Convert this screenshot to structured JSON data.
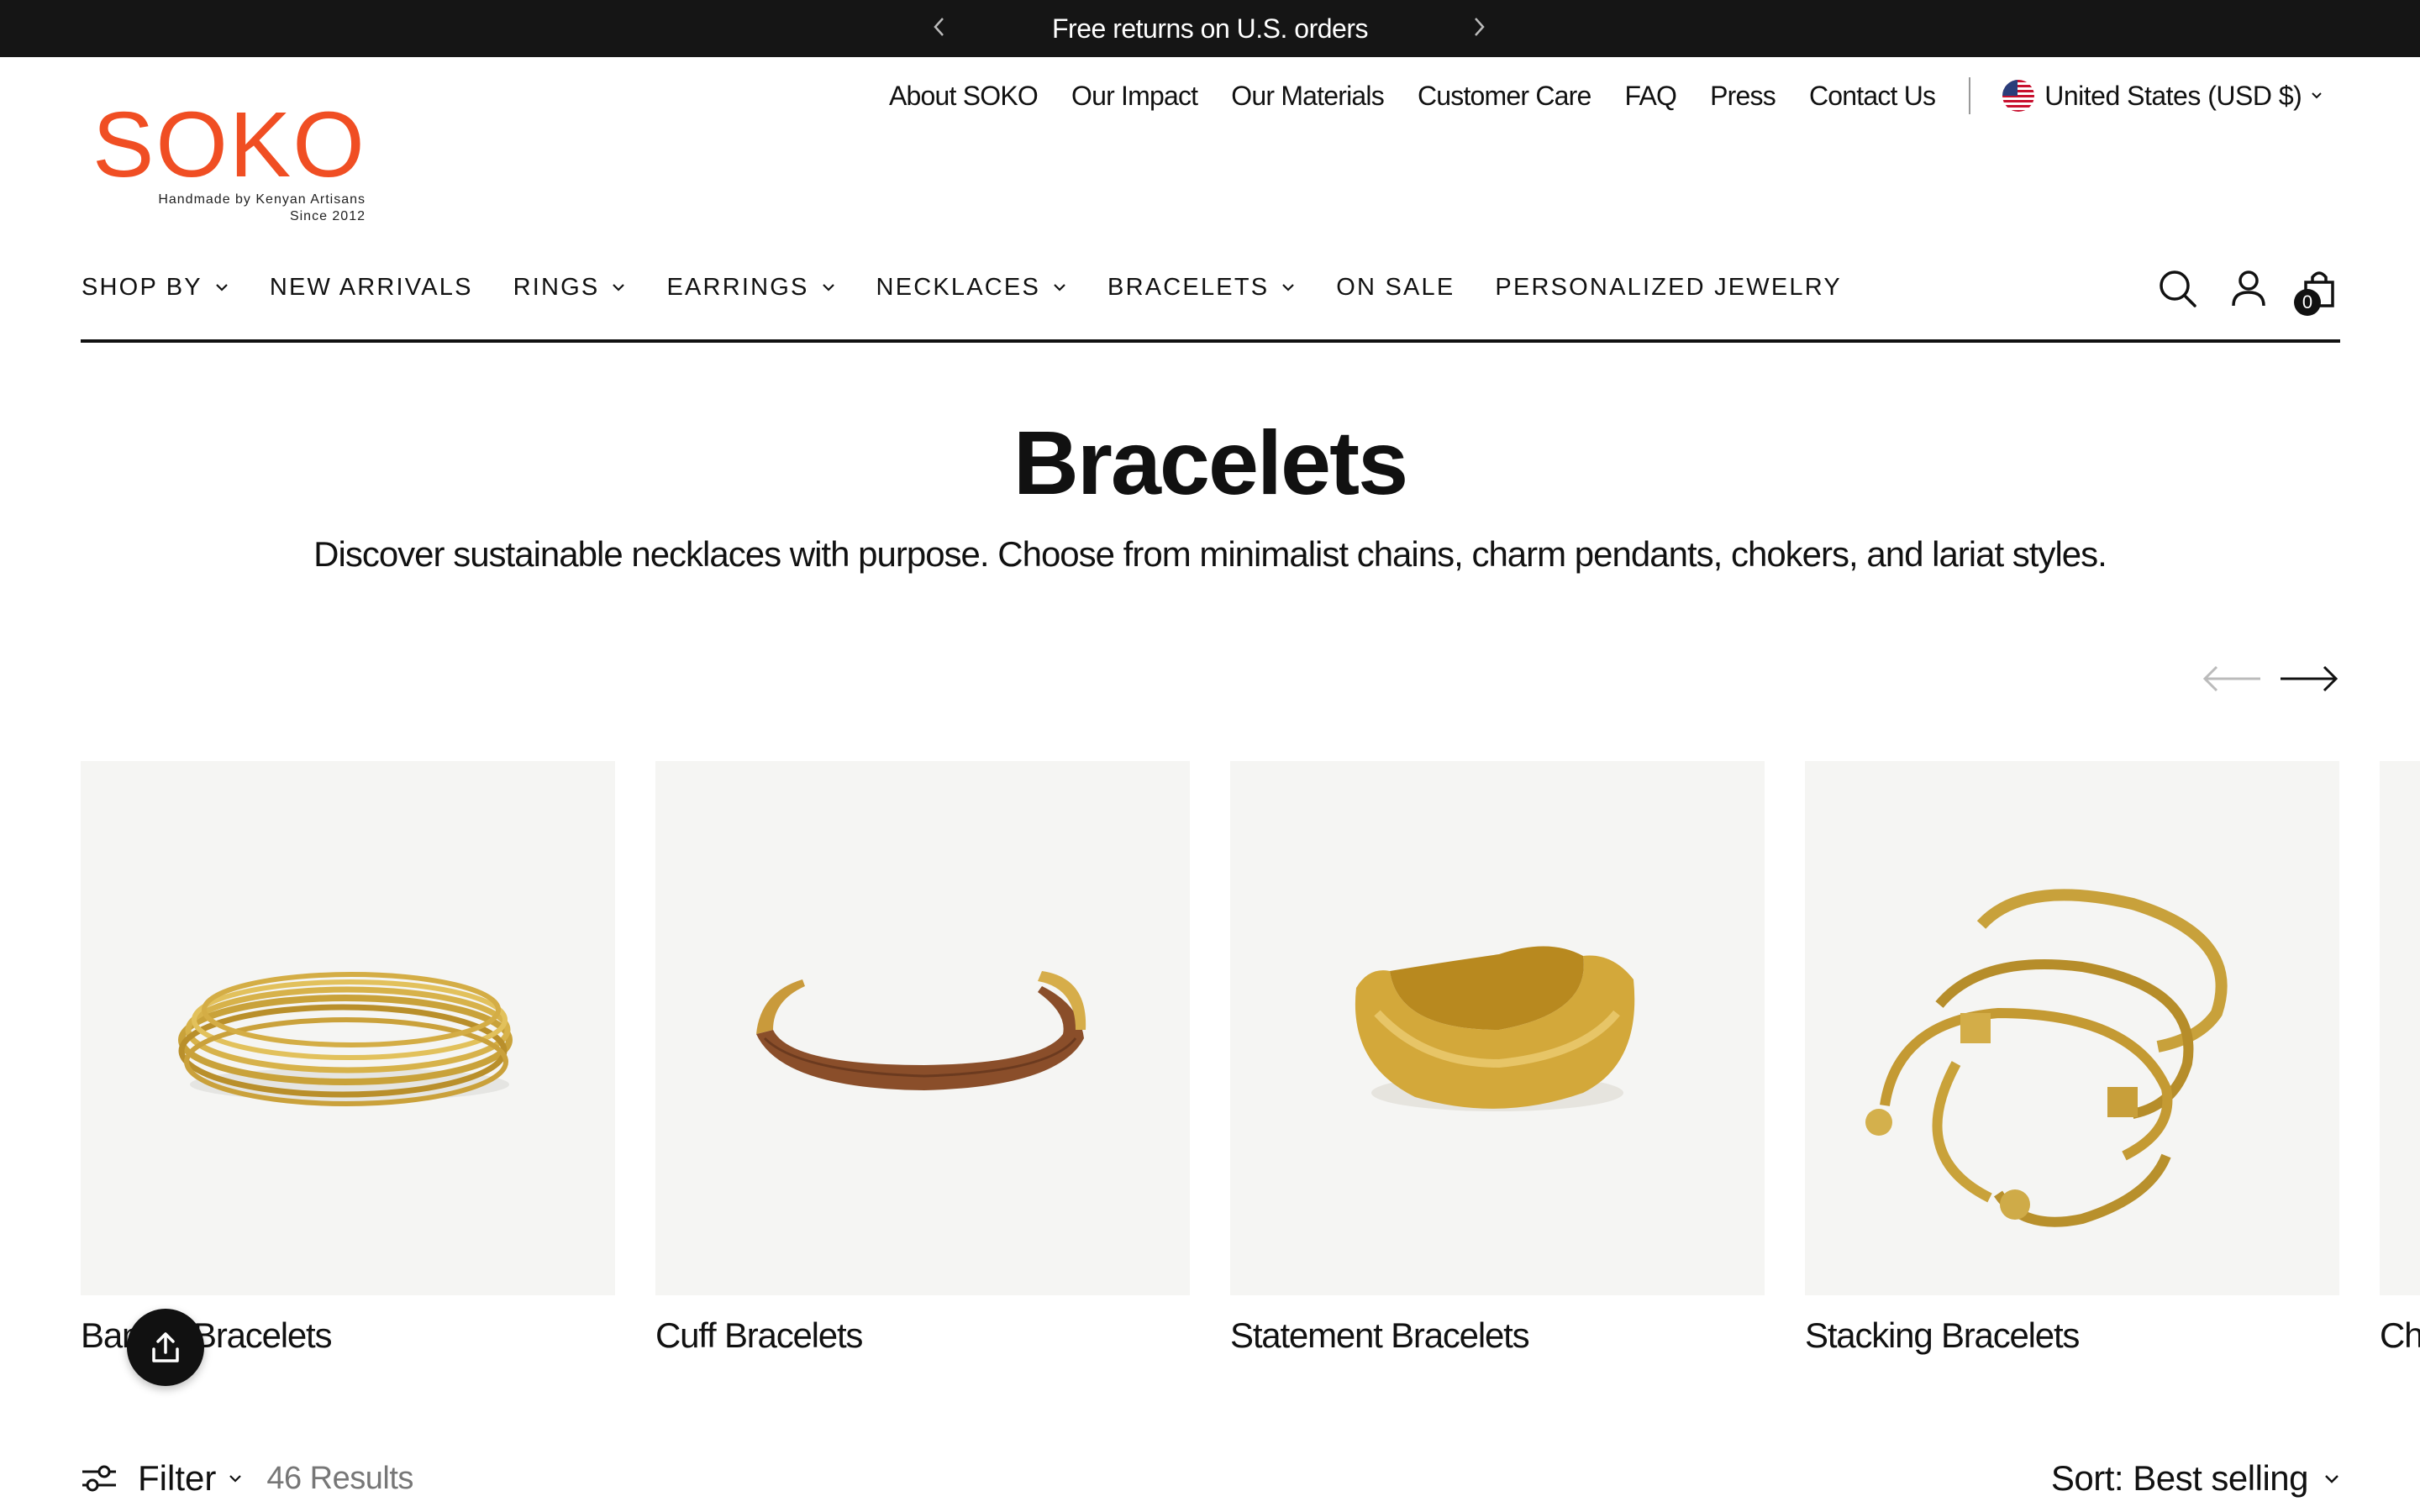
{
  "announcement": {
    "message": "Free returns on U.S. orders",
    "prev_icon": "chevron-left-icon",
    "next_icon": "chevron-right-icon"
  },
  "brand": {
    "name": "SOKO",
    "tagline_line1": "Handmade by Kenyan Artisans",
    "tagline_line2": "Since 2012",
    "color": "#f04e23"
  },
  "utility_nav": {
    "links": [
      "About SOKO",
      "Our Impact",
      "Our Materials",
      "Customer Care",
      "FAQ",
      "Press",
      "Contact Us"
    ],
    "country": "United States (USD $)"
  },
  "main_nav": {
    "items": [
      {
        "label": "SHOP BY",
        "dropdown": true
      },
      {
        "label": "NEW ARRIVALS",
        "dropdown": false
      },
      {
        "label": "RINGS",
        "dropdown": true
      },
      {
        "label": "EARRINGS",
        "dropdown": true
      },
      {
        "label": "NECKLACES",
        "dropdown": true
      },
      {
        "label": "BRACELETS",
        "dropdown": true
      },
      {
        "label": "ON SALE",
        "dropdown": false
      },
      {
        "label": "PERSONALIZED JEWELRY",
        "dropdown": false
      }
    ]
  },
  "header_icons": {
    "search": "search-icon",
    "account": "account-icon",
    "cart": "cart-icon",
    "cart_count": "0"
  },
  "collection": {
    "title": "Bracelets",
    "description": "Discover sustainable necklaces with purpose. Choose from minimalist chains, charm pendants, chokers, and lariat styles."
  },
  "carousel": {
    "prev_icon": "arrow-left-icon",
    "next_icon": "arrow-right-icon",
    "cards": [
      {
        "label": "Bangle Bracelets"
      },
      {
        "label": "Cuff Bracelets"
      },
      {
        "label": "Statement Bracelets"
      },
      {
        "label": "Stacking Bracelets"
      },
      {
        "label": "Ch"
      }
    ]
  },
  "toolbar": {
    "filter_label": "Filter",
    "results": "46 Results",
    "sort_label": "Sort: Best selling"
  },
  "share_button_icon": "share-icon"
}
